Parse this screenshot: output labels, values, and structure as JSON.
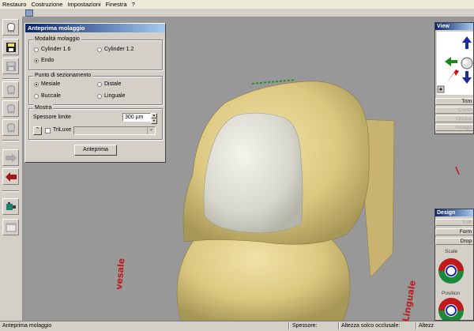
{
  "menu": [
    "Restauro",
    "Costruzione",
    "Impostazioni",
    "Finestra",
    "?"
  ],
  "dialog": {
    "title": "Anteprima molaggio",
    "grp_mode": "Modalità molaggio",
    "mode_options": [
      "Cylinder 1.6",
      "Cylinder 1.2",
      "Endo"
    ],
    "mode_selected": "Endo",
    "grp_section": "Punto di sezionamento",
    "section_options": [
      "Mesiale",
      "Distale",
      "Buccale",
      "Linguale"
    ],
    "section_selected": "Mesiale",
    "grp_show": "Mostra",
    "thickness_label": "Spessore limite",
    "thickness_value": "300 µm",
    "triluxe_label": "TriLuxe",
    "triluxe_checked": false,
    "preview_button": "Anteprima"
  },
  "view_panel": {
    "title": "View",
    "buttons": [
      "Trim",
      "Conto",
      "Occlus",
      "Antago"
    ],
    "disabled": [
      false,
      true,
      true,
      true
    ]
  },
  "design_panel": {
    "title": "Design",
    "buttons": [
      "Edit",
      "Form",
      "Drop"
    ],
    "disabled": [
      true,
      false,
      false
    ],
    "scale_label": "Scale",
    "position_label": "Position"
  },
  "viewport_labels": {
    "left": "vesale",
    "right": "Linguale"
  },
  "status": {
    "left": "Anteprima molaggio",
    "thickness": "Spessore:",
    "occlusal_height": "Altezza solco occlusale:",
    "height_short": "Altezz"
  },
  "colors": {
    "background": "#989898",
    "tooth": "#e0cf8e",
    "restoration": "#dcdcd4",
    "title_bar": "#0a246a",
    "red_text": "#c21a1a"
  },
  "icons": [
    "tooth-icon",
    "save-icon",
    "save-disabled-icon",
    "tooth-gray-icon",
    "arrow-right-icon",
    "arrow-left-red-icon",
    "tool-icon",
    "window-icon"
  ]
}
